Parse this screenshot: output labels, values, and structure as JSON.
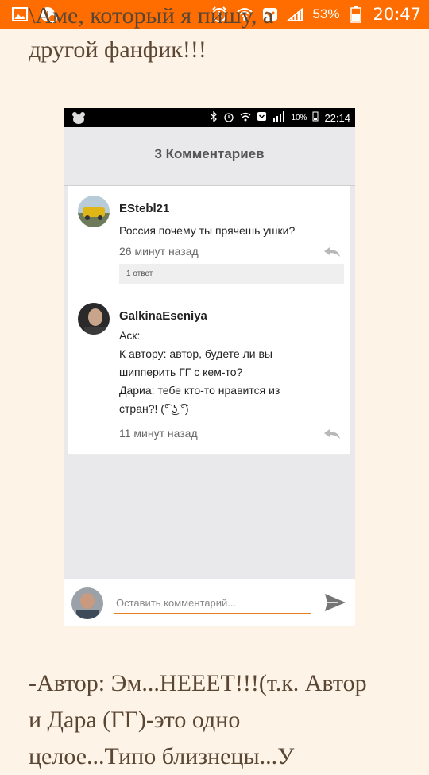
{
  "status_bar": {
    "battery_percent": "53%",
    "time": "20:47",
    "icons": [
      "gallery-icon",
      "notification-app-icon",
      "alarm-icon",
      "wifi-icon",
      "pocket-icon",
      "signal-icon",
      "battery-icon"
    ]
  },
  "story": {
    "top_clipped_line": "\\Аме, который я пишу, а",
    "top_line": "другой фанфик!!!",
    "bottom_lines": [
      "-Автор: Эм...НЕЕЕТ!!!(т.к. Автор",
      "и Дара (ГГ)-это одно",
      "целое...Типо близнецы...У"
    ]
  },
  "screenshot": {
    "status": {
      "battery_percent": "10%",
      "time": "22:14"
    },
    "header_title": "3 Комментариев",
    "comments": [
      {
        "user": "EStebl21",
        "text": "Россия почему ты прячешь ушки?",
        "time": "26 минут назад",
        "replies_label": "1 ответ"
      },
      {
        "user": "GalkinaEseniya",
        "text": "Аск:\nК автору: автор, будете ли вы\nшипперить ГГ с кем-то?\nДариа: тебе кто-то нравится из\nстран?! (͡° ͜ʖ ͡°)",
        "time": "11 минут назад"
      }
    ],
    "compose_placeholder": "Оставить комментарий...",
    "colors": {
      "accent": "#e67e22",
      "outer_status_bar": "#ff6d00",
      "page_background": "#fdf3e6"
    }
  }
}
